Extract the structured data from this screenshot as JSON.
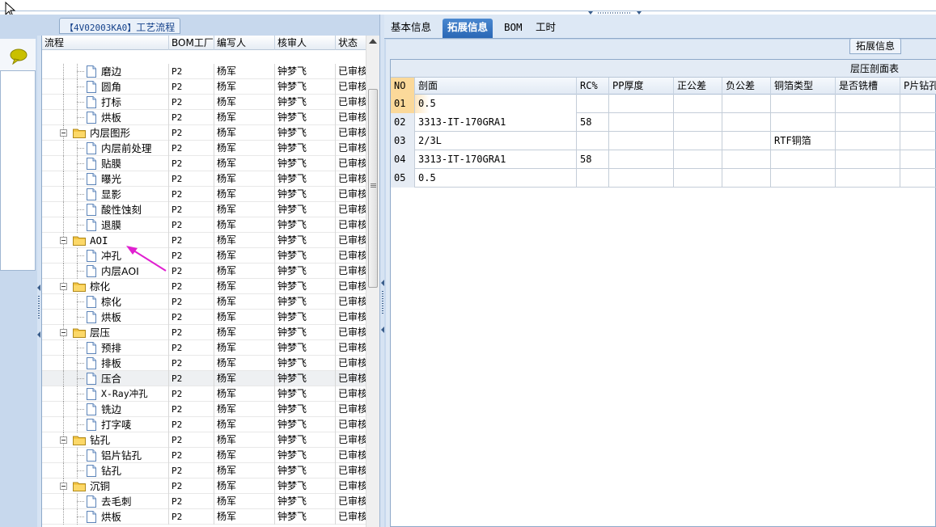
{
  "tree_panel": {
    "title_code": "【4V02003KA0】",
    "title_text": "工艺流程",
    "columns": [
      "流程",
      "BOM工厂",
      "编写人",
      "核审人",
      "状态"
    ],
    "rows": [
      {
        "label": "磨边",
        "level": 2,
        "type": "doc",
        "bom": "P2",
        "writer": "杨军",
        "reviewer": "钟梦飞",
        "status": "已审核"
      },
      {
        "label": "圆角",
        "level": 2,
        "type": "doc",
        "bom": "P2",
        "writer": "杨军",
        "reviewer": "钟梦飞",
        "status": "已审核"
      },
      {
        "label": "打标",
        "level": 2,
        "type": "doc",
        "bom": "P2",
        "writer": "杨军",
        "reviewer": "钟梦飞",
        "status": "已审核"
      },
      {
        "label": "烘板",
        "level": 2,
        "type": "doc",
        "bom": "P2",
        "writer": "杨军",
        "reviewer": "钟梦飞",
        "status": "已审核"
      },
      {
        "label": "内层图形",
        "level": 1,
        "type": "folder",
        "bom": "P2",
        "writer": "杨军",
        "reviewer": "钟梦飞",
        "status": "已审核"
      },
      {
        "label": "内层前处理",
        "level": 2,
        "type": "doc",
        "bom": "P2",
        "writer": "杨军",
        "reviewer": "钟梦飞",
        "status": "已审核"
      },
      {
        "label": "贴膜",
        "level": 2,
        "type": "doc",
        "bom": "P2",
        "writer": "杨军",
        "reviewer": "钟梦飞",
        "status": "已审核"
      },
      {
        "label": "曝光",
        "level": 2,
        "type": "doc",
        "bom": "P2",
        "writer": "杨军",
        "reviewer": "钟梦飞",
        "status": "已审核"
      },
      {
        "label": "显影",
        "level": 2,
        "type": "doc",
        "bom": "P2",
        "writer": "杨军",
        "reviewer": "钟梦飞",
        "status": "已审核"
      },
      {
        "label": "酸性蚀刻",
        "level": 2,
        "type": "doc",
        "bom": "P2",
        "writer": "杨军",
        "reviewer": "钟梦飞",
        "status": "已审核"
      },
      {
        "label": "退膜",
        "level": 2,
        "type": "doc",
        "bom": "P2",
        "writer": "杨军",
        "reviewer": "钟梦飞",
        "status": "已审核"
      },
      {
        "label": "AOI",
        "level": 1,
        "type": "folder",
        "bom": "P2",
        "writer": "杨军",
        "reviewer": "钟梦飞",
        "status": "已审核"
      },
      {
        "label": "冲孔",
        "level": 2,
        "type": "doc",
        "bom": "P2",
        "writer": "杨军",
        "reviewer": "钟梦飞",
        "status": "已审核"
      },
      {
        "label": "内层AOI",
        "level": 2,
        "type": "doc",
        "bom": "P2",
        "writer": "杨军",
        "reviewer": "钟梦飞",
        "status": "已审核"
      },
      {
        "label": "棕化",
        "level": 1,
        "type": "folder",
        "bom": "P2",
        "writer": "杨军",
        "reviewer": "钟梦飞",
        "status": "已审核"
      },
      {
        "label": "棕化",
        "level": 2,
        "type": "doc",
        "bom": "P2",
        "writer": "杨军",
        "reviewer": "钟梦飞",
        "status": "已审核"
      },
      {
        "label": "烘板",
        "level": 2,
        "type": "doc",
        "bom": "P2",
        "writer": "杨军",
        "reviewer": "钟梦飞",
        "status": "已审核"
      },
      {
        "label": "层压",
        "level": 1,
        "type": "folder",
        "bom": "P2",
        "writer": "杨军",
        "reviewer": "钟梦飞",
        "status": "已审核"
      },
      {
        "label": "预排",
        "level": 2,
        "type": "doc",
        "bom": "P2",
        "writer": "杨军",
        "reviewer": "钟梦飞",
        "status": "已审核"
      },
      {
        "label": "排板",
        "level": 2,
        "type": "doc",
        "bom": "P2",
        "writer": "杨军",
        "reviewer": "钟梦飞",
        "status": "已审核"
      },
      {
        "label": "压合",
        "level": 2,
        "type": "doc",
        "bom": "P2",
        "writer": "杨军",
        "reviewer": "钟梦飞",
        "status": "已审核",
        "selected": true
      },
      {
        "label": "X-Ray冲孔",
        "level": 2,
        "type": "doc",
        "bom": "P2",
        "writer": "杨军",
        "reviewer": "钟梦飞",
        "status": "已审核"
      },
      {
        "label": "铣边",
        "level": 2,
        "type": "doc",
        "bom": "P2",
        "writer": "杨军",
        "reviewer": "钟梦飞",
        "status": "已审核"
      },
      {
        "label": "打字唛",
        "level": 2,
        "type": "doc",
        "bom": "P2",
        "writer": "杨军",
        "reviewer": "钟梦飞",
        "status": "已审核"
      },
      {
        "label": "钻孔",
        "level": 1,
        "type": "folder",
        "bom": "P2",
        "writer": "杨军",
        "reviewer": "钟梦飞",
        "status": "已审核"
      },
      {
        "label": "铝片钻孔",
        "level": 2,
        "type": "doc",
        "bom": "P2",
        "writer": "杨军",
        "reviewer": "钟梦飞",
        "status": "已审核"
      },
      {
        "label": "钻孔",
        "level": 2,
        "type": "doc",
        "bom": "P2",
        "writer": "杨军",
        "reviewer": "钟梦飞",
        "status": "已审核"
      },
      {
        "label": "沉铜",
        "level": 1,
        "type": "folder",
        "bom": "P2",
        "writer": "杨军",
        "reviewer": "钟梦飞",
        "status": "已审核"
      },
      {
        "label": "去毛刺",
        "level": 2,
        "type": "doc",
        "bom": "P2",
        "writer": "杨军",
        "reviewer": "钟梦飞",
        "status": "已审核"
      },
      {
        "label": "烘板",
        "level": 2,
        "type": "doc",
        "bom": "P2",
        "writer": "杨军",
        "reviewer": "钟梦飞",
        "status": "已审核"
      }
    ]
  },
  "tabs": [
    {
      "label": "基本信息",
      "active": false
    },
    {
      "label": "拓展信息",
      "active": true
    },
    {
      "label": "BOM",
      "active": false
    },
    {
      "label": "工时",
      "active": false
    }
  ],
  "sub_tab_label": "拓展信息",
  "grid": {
    "caption": "层压剖面表",
    "columns": [
      "NO",
      "剖面",
      "RC%",
      "PP厚度",
      "正公差",
      "负公差",
      "铜箔类型",
      "是否铣槽",
      "P片钻孔"
    ],
    "rows": [
      {
        "no": "01",
        "section": "0.5",
        "rc": "",
        "pp": "",
        "pos_tol": "",
        "neg_tol": "",
        "foil": "",
        "slot": "",
        "pdrill": "",
        "current": true
      },
      {
        "no": "02",
        "section": "3313-IT-170GRA1",
        "rc": "58",
        "pp": "",
        "pos_tol": "",
        "neg_tol": "",
        "foil": "",
        "slot": "",
        "pdrill": ""
      },
      {
        "no": "03",
        "section": "2/3L",
        "rc": "",
        "pp": "",
        "pos_tol": "",
        "neg_tol": "",
        "foil": "RTF铜箔",
        "slot": "",
        "pdrill": ""
      },
      {
        "no": "04",
        "section": "3313-IT-170GRA1",
        "rc": "58",
        "pp": "",
        "pos_tol": "",
        "neg_tol": "",
        "foil": "",
        "slot": "",
        "pdrill": ""
      },
      {
        "no": "05",
        "section": "0.5",
        "rc": "",
        "pp": "",
        "pos_tol": "",
        "neg_tol": "",
        "foil": "",
        "slot": "",
        "pdrill": ""
      }
    ]
  },
  "colors": {
    "frame": "#c7d8ed",
    "active_tab": "#2a67b5",
    "row_highlight": "#fbd99a",
    "annotation_arrow": "#e020d0"
  },
  "icons": [
    "cursor-icon",
    "chat-bubble-icon",
    "folder-icon",
    "document-icon",
    "expander-icon",
    "scroll-up-arrow-icon",
    "annotation-arrow-icon"
  ]
}
